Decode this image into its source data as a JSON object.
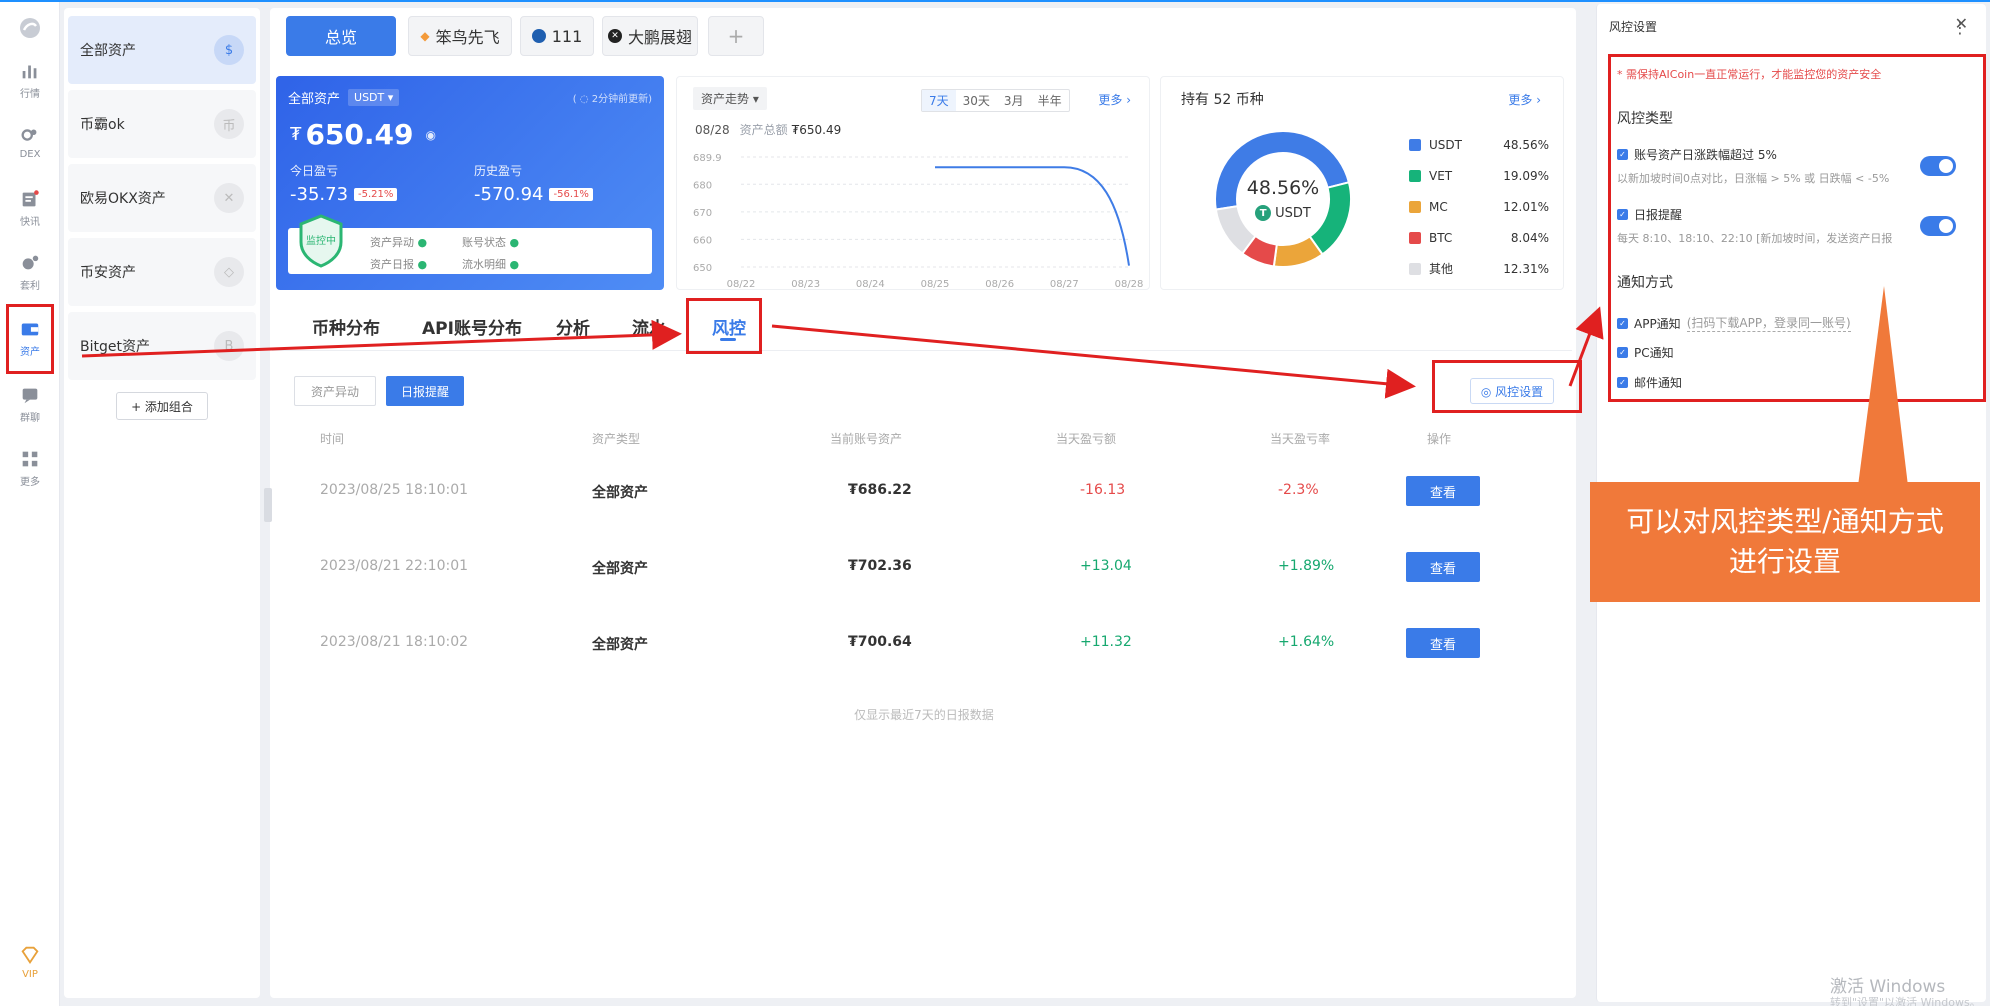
{
  "rail": {
    "items": [
      {
        "label": "行情"
      },
      {
        "label": "DEX"
      },
      {
        "label": "快讯"
      },
      {
        "label": "套利"
      },
      {
        "label": "资产"
      },
      {
        "label": "群聊"
      },
      {
        "label": "更多"
      }
    ],
    "vip": "VIP"
  },
  "accounts": {
    "items": [
      {
        "label": "全部资产",
        "icon": "$"
      },
      {
        "label": "币霸ok",
        "icon": "币"
      },
      {
        "label": "欧易OKX资产",
        "icon": "✕"
      },
      {
        "label": "币安资产",
        "icon": "◇"
      },
      {
        "label": "Bitget资产",
        "icon": "B"
      }
    ],
    "add_label": "+ 添加组合"
  },
  "top_tabs": [
    {
      "label": "总览"
    },
    {
      "label": "笨鸟先飞"
    },
    {
      "label": "111"
    },
    {
      "label": "大鹏展翅"
    },
    {
      "label": "+"
    }
  ],
  "asset_card": {
    "title": "全部资产",
    "currency": "USDT ▾",
    "update_note": "( ◌ 2分钟前更新)",
    "total": "650.49",
    "currency_symbol": "₮",
    "today_label": "今日盈亏",
    "today_value": "-35.73",
    "today_pct": "-5.21%",
    "hist_label": "历史盈亏",
    "hist_value": "-570.94",
    "hist_pct": "-56.1%",
    "shield_text": "监控中",
    "monitors": [
      "资产异动",
      "账号状态",
      "资产日报",
      "流水明细"
    ]
  },
  "trend": {
    "selector": "资产走势 ▾",
    "ranges": [
      "7天",
      "30天",
      "3月",
      "半年"
    ],
    "more": "更多 ›",
    "date": "08/28",
    "total_label": "资产总额",
    "total_value": "₮650.49"
  },
  "chart_data": {
    "type": "line",
    "x": [
      "08/22",
      "08/23",
      "08/24",
      "08/25",
      "08/26",
      "08/27",
      "08/28"
    ],
    "yticks": [
      "689.9",
      "680",
      "670",
      "660",
      "650"
    ],
    "ylim": [
      650,
      689.9
    ],
    "series": [
      {
        "values": [
          null,
          null,
          null,
          686.2,
          686.2,
          686.2,
          650.49
        ]
      }
    ]
  },
  "holdings": {
    "title": "持有 52 币种",
    "more": "更多 ›",
    "center_pct": "48.56%",
    "center_label": "USDT",
    "center_icon": "T",
    "slices": [
      {
        "name": "USDT",
        "pct": "48.56%",
        "value": 48.56,
        "color": "#3f7ce6"
      },
      {
        "name": "VET",
        "pct": "19.09%",
        "value": 19.09,
        "color": "#16b37a"
      },
      {
        "name": "MC",
        "pct": "12.01%",
        "value": 12.01,
        "color": "#eba53a"
      },
      {
        "name": "BTC",
        "pct": "8.04%",
        "value": 8.04,
        "color": "#e54a4a"
      },
      {
        "name": "其他",
        "pct": "12.31%",
        "value": 12.31,
        "color": "#dedfe3"
      }
    ]
  },
  "section_tabs": [
    {
      "label": "币种分布"
    },
    {
      "label": "API账号分布"
    },
    {
      "label": "分析"
    },
    {
      "label": "流水"
    },
    {
      "label": "风控"
    }
  ],
  "sub_tabs": [
    {
      "label": "资产异动"
    },
    {
      "label": "日报提醒"
    }
  ],
  "risk_settings_button": "◎ 风控设置",
  "table": {
    "headers": [
      "时间",
      "资产类型",
      "当前账号资产",
      "当天盈亏额",
      "当天盈亏率",
      "操作"
    ],
    "rows": [
      {
        "time": "2023/08/25 18:10:01",
        "type": "全部资产",
        "asset": "₮686.22",
        "pnl": "-16.13",
        "rate": "-2.3%",
        "action": "查看",
        "up": false
      },
      {
        "time": "2023/08/21 22:10:01",
        "type": "全部资产",
        "asset": "₮702.36",
        "pnl": "+13.04",
        "rate": "+1.89%",
        "action": "查看",
        "up": true
      },
      {
        "time": "2023/08/21 18:10:02",
        "type": "全部资产",
        "asset": "₮700.64",
        "pnl": "+11.32",
        "rate": "+1.64%",
        "action": "查看",
        "up": true
      }
    ],
    "footnote": "仅显示最近7天的日报数据"
  },
  "panel": {
    "title": "风控设置",
    "close": "✕",
    "warning": "* 需保持AICoin一直正常运行，才能监控您的资产安全",
    "risk_type_title": "风控类型",
    "risk_items": [
      {
        "label": "账号资产日涨跌幅超过 5%",
        "desc": "以新加坡时间0点对比，日涨幅 > 5% 或 日跌幅 < -5%"
      },
      {
        "label": "日报提醒",
        "desc": "每天 8:10、18:10、22:10 [新加坡时间，发送资产日报"
      }
    ],
    "notify_title": "通知方式",
    "notify_items": [
      {
        "label": "APP通知",
        "note": "(扫码下载APP，登录同一账号)"
      },
      {
        "label": "PC通知",
        "note": ""
      },
      {
        "label": "邮件通知",
        "note": ""
      }
    ]
  },
  "callout": {
    "line1": "可以对风控类型/通知方式",
    "line2": "进行设置"
  },
  "watermark": {
    "line1": "激活 Windows",
    "line2": "转到\"设置\"以激活 Windows。"
  }
}
